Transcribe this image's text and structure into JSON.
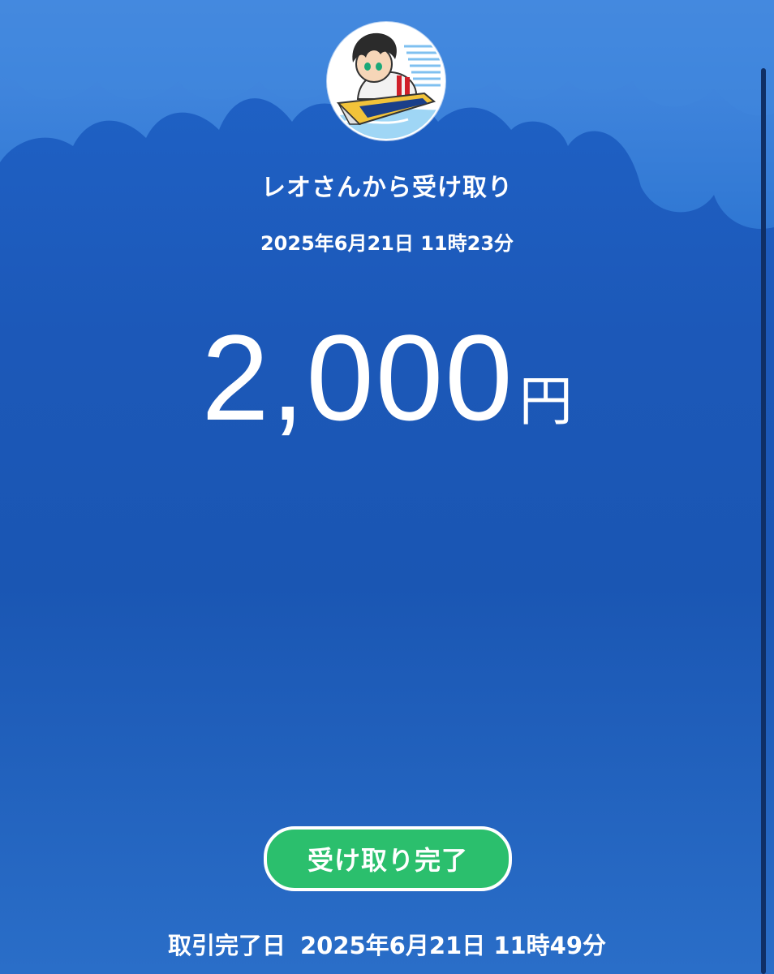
{
  "receipt": {
    "title": "レオさんから受け取り",
    "date": "2025年6月21日 11時23分",
    "amount": "2,000",
    "currency": "円",
    "status_button": "受け取り完了",
    "completed_label": "取引完了日",
    "completed_date": "2025年6月21日 11時49分"
  },
  "avatar": {
    "icon": "boat-racer-avatar-icon"
  },
  "colors": {
    "background": "#1c58b8",
    "clouds": "#2f7bd6",
    "status_button": "#2bbf6d",
    "text": "#ffffff"
  }
}
